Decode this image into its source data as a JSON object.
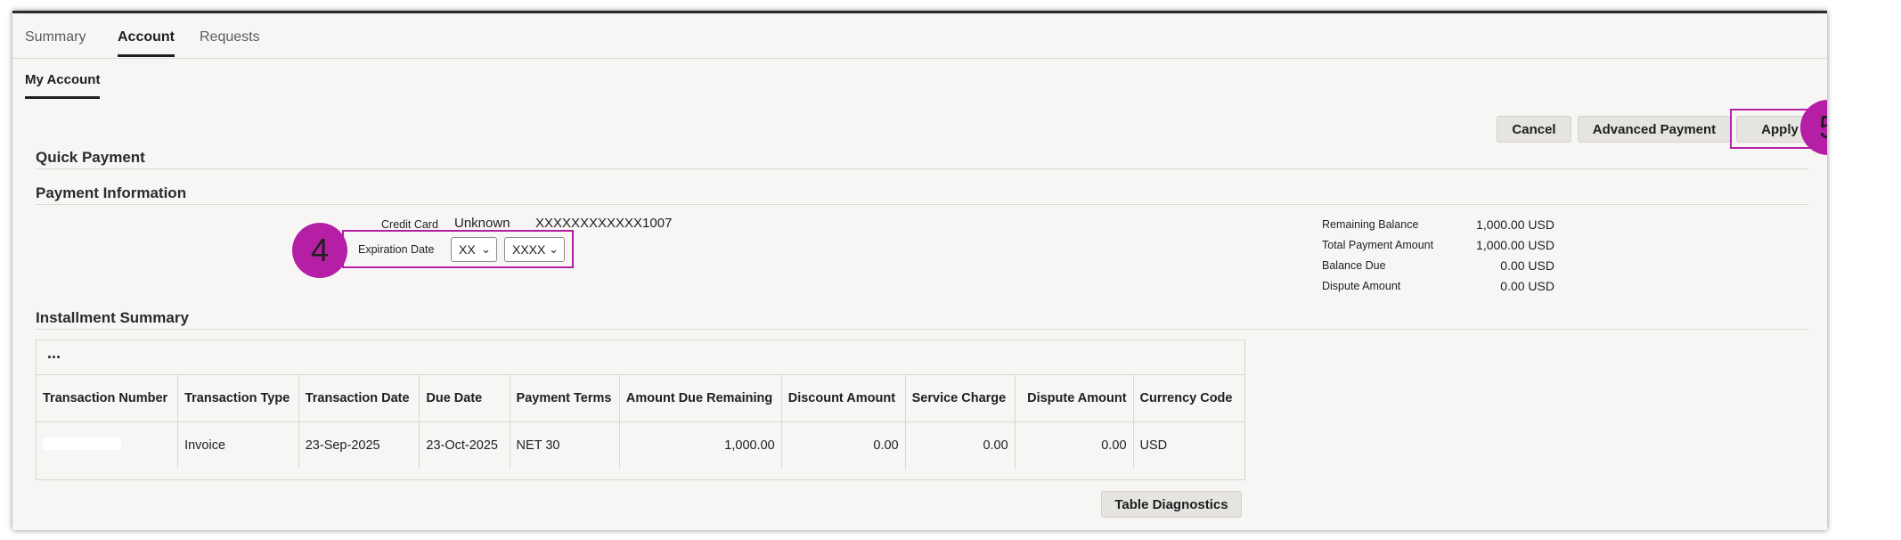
{
  "tabs": [
    "Summary",
    "Account",
    "Requests"
  ],
  "subtab": "My Account",
  "actions": {
    "cancel": "Cancel",
    "advanced_payment": "Advanced Payment",
    "apply": "Apply"
  },
  "callouts": {
    "step4": "4",
    "step5": "5"
  },
  "sections": {
    "quick_payment": "Quick Payment",
    "payment_information": "Payment Information",
    "installment_summary": "Installment Summary"
  },
  "payment": {
    "credit_card_label": "Credit Card",
    "credit_card_type": "Unknown",
    "credit_card_number": "XXXXXXXXXXXX1007",
    "expiration_label": "Expiration Date",
    "exp_month": "XX",
    "exp_year": "XXXX"
  },
  "balances": [
    {
      "label": "Remaining Balance",
      "value": "1,000.00 USD"
    },
    {
      "label": "Total Payment Amount",
      "value": "1,000.00 USD"
    },
    {
      "label": "Balance Due",
      "value": "0.00 USD"
    },
    {
      "label": "Dispute Amount",
      "value": "0.00 USD"
    }
  ],
  "table": {
    "toolbar_more": "...",
    "headers": [
      "Transaction Number",
      "Transaction Type",
      "Transaction Date",
      "Due Date",
      "Payment Terms",
      "Amount Due Remaining",
      "Discount Amount",
      "Service Charge",
      "Dispute Amount",
      "Currency Code"
    ],
    "row": {
      "transaction_type": "Invoice",
      "transaction_date": "23-Sep-2025",
      "due_date": "23-Oct-2025",
      "payment_terms": "NET 30",
      "amount_due_remaining": "1,000.00",
      "discount_amount": "0.00",
      "service_charge": "0.00",
      "dispute_amount": "0.00",
      "currency_code": "USD"
    },
    "diagnostics_button": "Table Diagnostics"
  },
  "colors": {
    "accent": "#b41fa6",
    "background": "#f7f6f4",
    "button": "#e6e4e1"
  }
}
